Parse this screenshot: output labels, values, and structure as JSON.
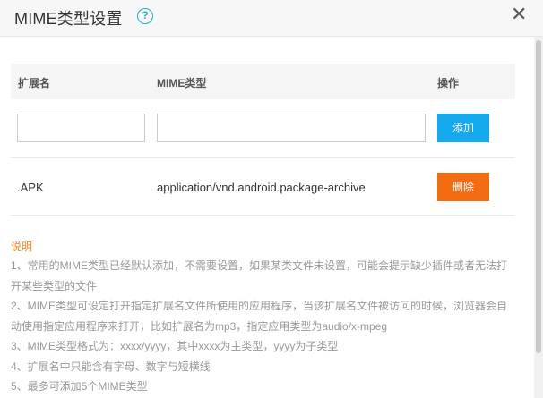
{
  "dialog": {
    "title": "MIME类型设置",
    "help_icon": "question-circle-icon",
    "help_glyph": "?",
    "close_icon": "close-icon",
    "close_glyph": "✕"
  },
  "table": {
    "headers": [
      "扩展名",
      "MIME类型",
      "操作"
    ],
    "input_row": {
      "ext_value": "",
      "mime_value": "",
      "add_label": "添加"
    },
    "rows": [
      {
        "ext": ".APK",
        "mime": "application/vnd.android.package-archive",
        "action_label": "删除"
      }
    ]
  },
  "notes": {
    "title": "说明",
    "items": [
      "1、常用的MIME类型已经默认添加，不需要设置，如果某类文件未设置，可能会提示缺少插件或者无法打开某些类型的文件",
      "2、MIME类型可设定打开指定扩展名文件所使用的应用程序，当该扩展名文件被访问的时候，浏览器会自动使用指定应用程序来打开，比如扩展名为mp3，指定应用类型为audio/x-mpeg",
      "3、MIME类型格式为：xxxx/yyyy，其中xxxx为主类型，yyyy为子类型",
      "4、扩展名中只能含有字母、数字与短横线",
      "5、最多可添加5个MIME类型"
    ]
  },
  "colors": {
    "accent_blue": "#14a9ec",
    "danger_orange": "#f26d12",
    "notes_title": "#f08a1c"
  }
}
